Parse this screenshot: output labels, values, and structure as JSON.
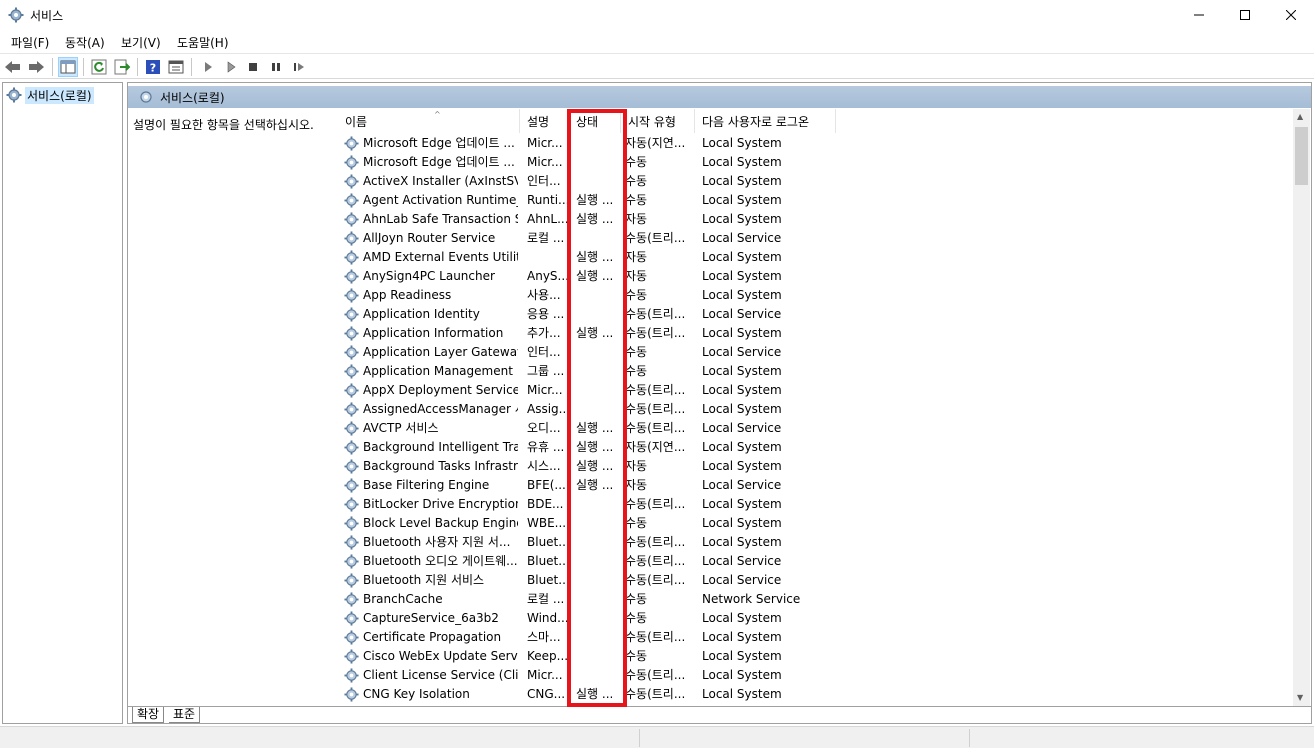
{
  "window": {
    "title": "서비스"
  },
  "menu": [
    {
      "label": "파일(F)"
    },
    {
      "label": "동작(A)"
    },
    {
      "label": "보기(V)"
    },
    {
      "label": "도움말(H)"
    }
  ],
  "tree": {
    "root_label": "서비스(로컬)"
  },
  "pane": {
    "header": "서비스(로컬)",
    "description": "설명이 필요한 항목을 선택하십시오."
  },
  "columns": {
    "name": "이름",
    "description": "설명",
    "status": "상태",
    "startup": "시작 유형",
    "logon": "다음 사용자로 로그온"
  },
  "services": [
    {
      "name": "Microsoft Edge 업데이트 ...",
      "desc": "Micr...",
      "status": "",
      "startup": "자동(지연...",
      "logon": "Local System"
    },
    {
      "name": "Microsoft Edge 업데이트 ...",
      "desc": "Micr...",
      "status": "",
      "startup": "수동",
      "logon": "Local System"
    },
    {
      "name": "ActiveX Installer (AxInstSV)",
      "desc": "인터...",
      "status": "",
      "startup": "수동",
      "logon": "Local System"
    },
    {
      "name": "Agent Activation Runtime_...",
      "desc": "Runti...",
      "status": "실행 ...",
      "startup": "수동",
      "logon": "Local System"
    },
    {
      "name": "AhnLab Safe Transaction S...",
      "desc": "AhnL...",
      "status": "실행 ...",
      "startup": "자동",
      "logon": "Local System"
    },
    {
      "name": "AllJoyn Router Service",
      "desc": "로컬 ...",
      "status": "",
      "startup": "수동(트리...",
      "logon": "Local Service"
    },
    {
      "name": "AMD External Events Utility",
      "desc": "",
      "status": "실행 ...",
      "startup": "자동",
      "logon": "Local System"
    },
    {
      "name": "AnySign4PC Launcher",
      "desc": "AnyS...",
      "status": "실행 ...",
      "startup": "자동",
      "logon": "Local System"
    },
    {
      "name": "App Readiness",
      "desc": "사용...",
      "status": "",
      "startup": "수동",
      "logon": "Local System"
    },
    {
      "name": "Application Identity",
      "desc": "응용 ...",
      "status": "",
      "startup": "수동(트리...",
      "logon": "Local Service"
    },
    {
      "name": "Application Information",
      "desc": "추가...",
      "status": "실행 ...",
      "startup": "수동(트리...",
      "logon": "Local System"
    },
    {
      "name": "Application Layer Gateway ...",
      "desc": "인터...",
      "status": "",
      "startup": "수동",
      "logon": "Local Service"
    },
    {
      "name": "Application Management",
      "desc": "그룹 ...",
      "status": "",
      "startup": "수동",
      "logon": "Local System"
    },
    {
      "name": "AppX Deployment Service ...",
      "desc": "Micr...",
      "status": "",
      "startup": "수동(트리...",
      "logon": "Local System"
    },
    {
      "name": "AssignedAccessManager 서...",
      "desc": "Assig...",
      "status": "",
      "startup": "수동(트리...",
      "logon": "Local System"
    },
    {
      "name": "AVCTP 서비스",
      "desc": "오디...",
      "status": "실행 ...",
      "startup": "수동(트리...",
      "logon": "Local Service"
    },
    {
      "name": "Background Intelligent Tra...",
      "desc": "유휴 ...",
      "status": "실행 ...",
      "startup": "자동(지연...",
      "logon": "Local System"
    },
    {
      "name": "Background Tasks Infrastru...",
      "desc": "시스...",
      "status": "실행 ...",
      "startup": "자동",
      "logon": "Local System"
    },
    {
      "name": "Base Filtering Engine",
      "desc": "BFE(...",
      "status": "실행 ...",
      "startup": "자동",
      "logon": "Local Service"
    },
    {
      "name": "BitLocker Drive Encryption ...",
      "desc": "BDE...",
      "status": "",
      "startup": "수동(트리...",
      "logon": "Local System"
    },
    {
      "name": "Block Level Backup Engine ...",
      "desc": "WBE...",
      "status": "",
      "startup": "수동",
      "logon": "Local System"
    },
    {
      "name": "Bluetooth 사용자 지원 서...",
      "desc": "Bluet...",
      "status": "",
      "startup": "수동(트리...",
      "logon": "Local System"
    },
    {
      "name": "Bluetooth 오디오 게이트웨...",
      "desc": "Bluet...",
      "status": "",
      "startup": "수동(트리...",
      "logon": "Local Service"
    },
    {
      "name": "Bluetooth 지원 서비스",
      "desc": "Bluet...",
      "status": "",
      "startup": "수동(트리...",
      "logon": "Local Service"
    },
    {
      "name": "BranchCache",
      "desc": "로컬 ...",
      "status": "",
      "startup": "수동",
      "logon": "Network Service"
    },
    {
      "name": "CaptureService_6a3b2",
      "desc": "Wind...",
      "status": "",
      "startup": "수동",
      "logon": "Local System"
    },
    {
      "name": "Certificate Propagation",
      "desc": "스마...",
      "status": "",
      "startup": "수동(트리...",
      "logon": "Local System"
    },
    {
      "name": "Cisco WebEx Update Service",
      "desc": "Keep...",
      "status": "",
      "startup": "수동",
      "logon": "Local System"
    },
    {
      "name": "Client License Service (Clip...",
      "desc": "Micr...",
      "status": "",
      "startup": "수동(트리...",
      "logon": "Local System"
    },
    {
      "name": "CNG Key Isolation",
      "desc": "CNG...",
      "status": "실행 ...",
      "startup": "수동(트리...",
      "logon": "Local System"
    }
  ],
  "tabs": [
    {
      "label": "확장"
    },
    {
      "label": "표준"
    }
  ],
  "colors": {
    "highlight": "#e8141c",
    "header_bg": "#a5bdd6",
    "selection": "#cce8ff"
  }
}
